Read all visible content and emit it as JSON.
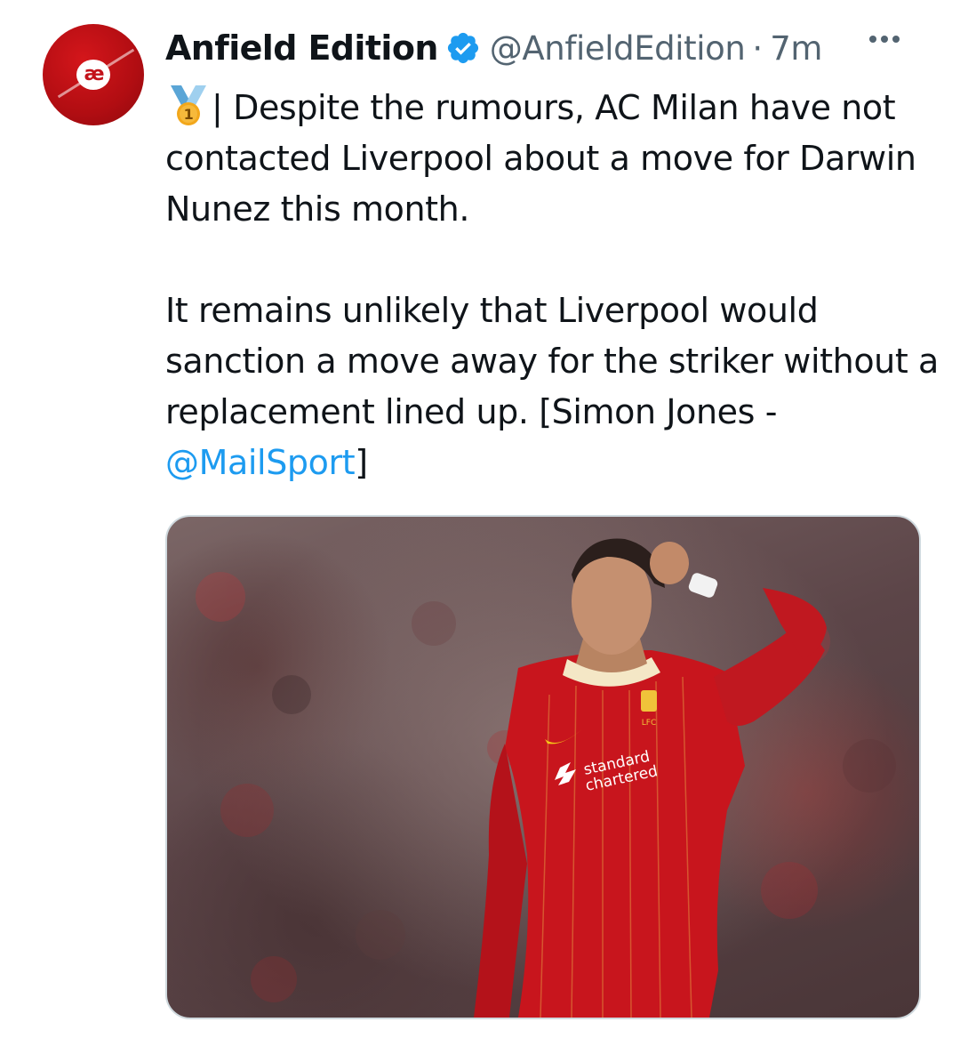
{
  "tweet": {
    "author_name": "Anfield Edition",
    "avatar_text": "æ",
    "handle": "@AnfieldEdition",
    "separator": "·",
    "time": "7m",
    "paragraphs": [
      {
        "prefix": "| Despite the rumours, AC Milan have not contacted Liverpool about a move for Darwin Nunez this month."
      },
      {
        "text": "It remains unlikely that Liverpool would sanction a move away for the striker without a replacement lined up. [Simon Jones - ",
        "mention": "@MailSport",
        "suffix": "]"
      }
    ],
    "medal_number": "1",
    "media": {
      "kit_sponsor_line1": "standard",
      "kit_sponsor_line2": "chartered",
      "kit_crest_text": "LFC"
    }
  },
  "colors": {
    "link": "#1d9bf0",
    "secondary_text": "#536471",
    "verified": "#1d9bf0",
    "avatar": "#c3121a"
  },
  "icons": [
    "verified-badge-icon",
    "more-options-icon",
    "medal-emoji-icon"
  ]
}
